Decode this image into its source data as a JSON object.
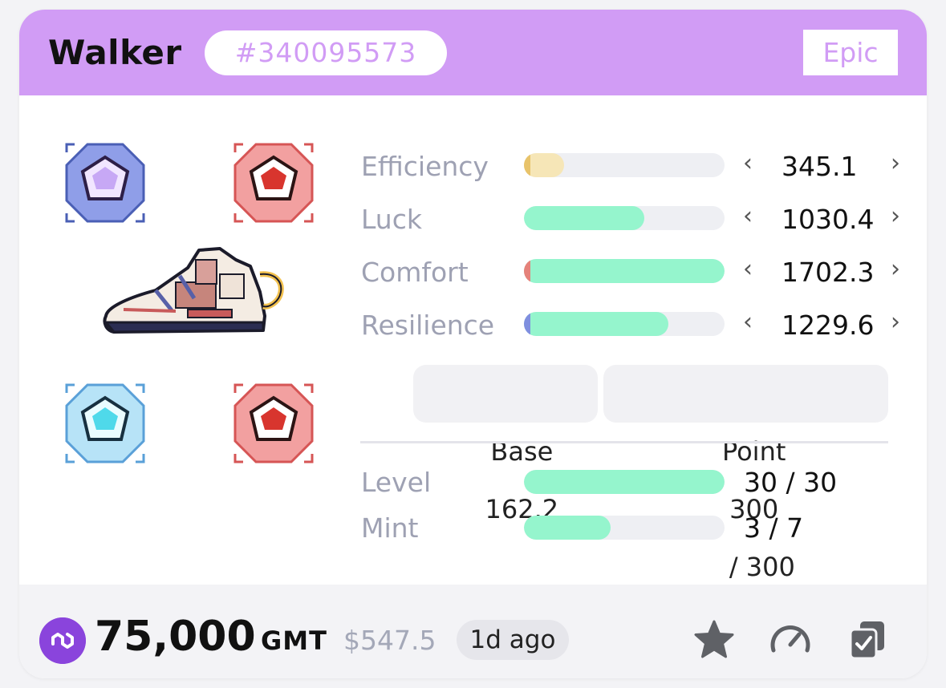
{
  "header": {
    "title": "Walker",
    "id": "#340095573",
    "rarity": "Epic",
    "color": "#d19cf5"
  },
  "gems": [
    {
      "name": "purple-gem-icon",
      "color": "#8f9ee8"
    },
    {
      "name": "red-gem-icon",
      "color": "#f2a0a0"
    },
    {
      "name": "blue-gem-icon",
      "color": "#b7e3f7"
    },
    {
      "name": "red-gem-icon",
      "color": "#f2a0a0"
    }
  ],
  "stats": [
    {
      "label": "Efficiency",
      "value": "345.1",
      "fill": 0.2,
      "marker_color": "#e8c36a",
      "fill_color": "#f6e6b7"
    },
    {
      "label": "Luck",
      "value": "1030.4",
      "fill": 0.6,
      "marker_color": "#95f5cd",
      "fill_color": "#95f5cd"
    },
    {
      "label": "Comfort",
      "value": "1702.3",
      "fill": 1.0,
      "marker_color": "#e5827a",
      "fill_color": "#95f5cd"
    },
    {
      "label": "Resilience",
      "value": "1229.6",
      "fill": 0.72,
      "marker_color": "#7f8fdf",
      "fill_color": "#95f5cd"
    }
  ],
  "base": {
    "label": "Base",
    "value": "162.2"
  },
  "points": {
    "label": "Point",
    "value": "300",
    "max": "/ 300"
  },
  "level": {
    "label": "Level",
    "value": "30 / 30",
    "fill": 1.0
  },
  "mint": {
    "label": "Mint",
    "value": "3 / 7",
    "fill": 0.43
  },
  "footer": {
    "price": "75,000",
    "unit": "GMT",
    "usd": "$547.5",
    "listed": "1d ago",
    "icons": [
      "polygon-icon",
      "star-icon",
      "speedometer-icon",
      "copy-check-icon"
    ]
  }
}
